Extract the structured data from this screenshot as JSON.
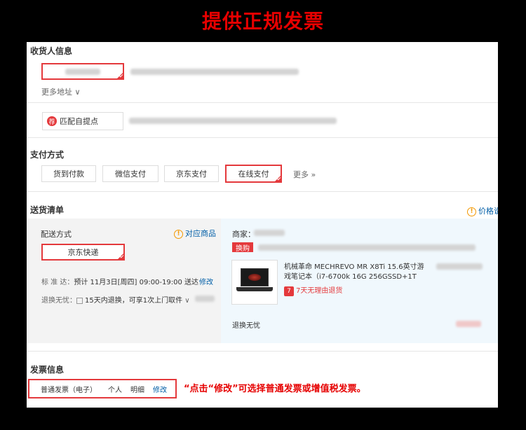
{
  "banner": {
    "title": "提供正规发票"
  },
  "shipping_address": {
    "title": "收货人信息",
    "more_address": "更多地址",
    "pickup_button": "匹配自提点",
    "pickup_icon_text": "荐"
  },
  "payment": {
    "title": "支付方式",
    "options": [
      "货到付款",
      "微信支付",
      "京东支付",
      "在线支付"
    ],
    "selected": "在线支付",
    "more": "更多 »"
  },
  "delivery_list": {
    "title": "送货清单",
    "price_note": "价格说",
    "method_label": "配送方式",
    "matching_products": "对应商品",
    "selected_method": "京东快递",
    "standard_label": "标 准 达：",
    "standard_value": "预计 11月3日[周四] 09:00-19:00 送达",
    "modify": "修改",
    "return_label": "退换无忧：",
    "return_value": "15天内退换，可享1次上门取件",
    "seller_label": "商家：",
    "huangou_tag": "换购",
    "product_name_line1": "机械革命 MECHREVO MR X8Ti 15.6英寸游",
    "product_name_line2": "戏笔记本（i7-6700k 16G 256GSSD+1T",
    "no_reason_return": "7天无理由退货",
    "seven_icon": "7",
    "worry_free": "退换无忧"
  },
  "invoice": {
    "title": "发票信息",
    "type": "普通发票（电子）",
    "recipient": "个人",
    "content": "明细",
    "modify": "修改",
    "note": "“点击“修改”可选择普通发票或增值税发票。"
  },
  "colors": {
    "accent_red": "#e4393c",
    "banner_red": "#e60000",
    "link_blue": "#005ea7",
    "warning_orange": "#f39800"
  }
}
